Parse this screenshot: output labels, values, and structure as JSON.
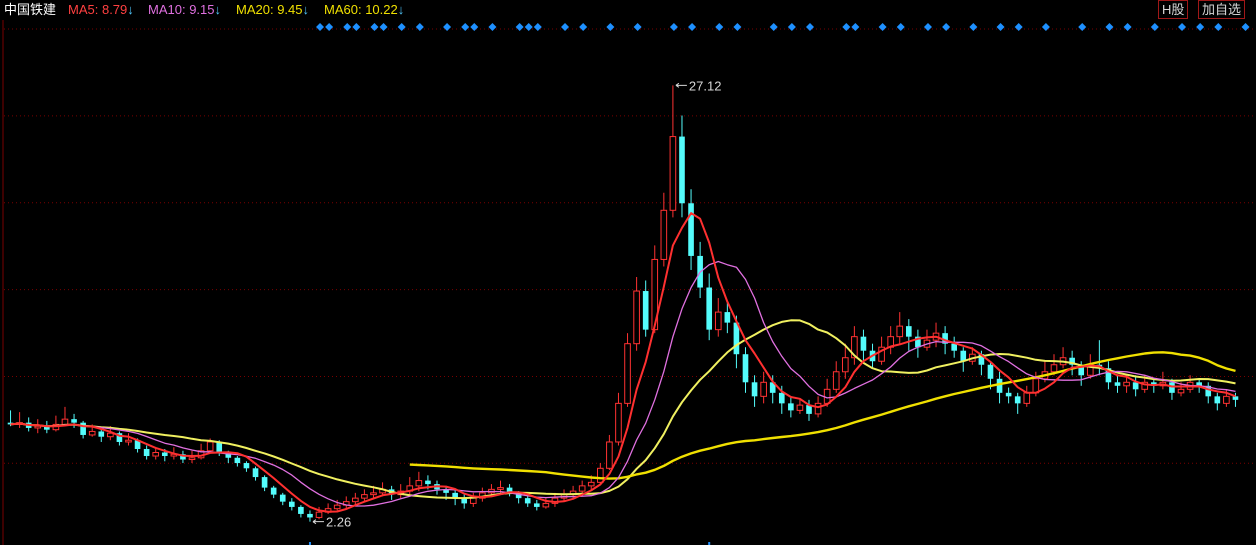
{
  "header": {
    "stock_name": "中国铁建",
    "indicators": [
      {
        "label": "MA5",
        "value": "8.79",
        "color": "#ff4040"
      },
      {
        "label": "MA10",
        "value": "9.15",
        "color": "#e070e0"
      },
      {
        "label": "MA20",
        "value": "9.45",
        "color": "#f0e000"
      },
      {
        "label": "MA60",
        "value": "10.22",
        "color": "#f0e000"
      }
    ],
    "arrow_glyph": "↓",
    "arrow_color": "#4fc3f7",
    "buttons": {
      "h_share": "H股",
      "add_watchlist": "加自选"
    }
  },
  "chart_data": {
    "type": "candlestick",
    "ylim": [
      1.5,
      30.5
    ],
    "grid": true,
    "max_label": "27.12",
    "min_label": "2.26",
    "colors": {
      "up": "#ff3232",
      "down": "#54fcfc",
      "ma5": "#ff3030",
      "ma10": "#e070e0",
      "ma20": "#f0f060",
      "ma60": "#f0e000",
      "marker": "#1e90ff",
      "grid": "#7a0000"
    },
    "candles": [
      [
        7.9,
        7.8,
        8.6,
        7.7
      ],
      [
        7.8,
        7.9,
        8.5,
        7.6
      ],
      [
        7.9,
        7.6,
        8.2,
        7.4
      ],
      [
        7.6,
        7.7,
        8.1,
        7.3
      ],
      [
        7.7,
        7.5,
        8.0,
        7.3
      ],
      [
        7.5,
        7.8,
        8.3,
        7.4
      ],
      [
        7.8,
        8.1,
        8.8,
        7.7
      ],
      [
        8.1,
        7.9,
        8.4,
        7.6
      ],
      [
        7.9,
        7.2,
        8.0,
        7.0
      ],
      [
        7.2,
        7.4,
        7.8,
        7.1
      ],
      [
        7.4,
        7.1,
        7.6,
        6.8
      ],
      [
        7.1,
        7.3,
        7.7,
        6.9
      ],
      [
        7.3,
        6.8,
        7.4,
        6.6
      ],
      [
        6.8,
        6.9,
        7.3,
        6.6
      ],
      [
        6.9,
        6.4,
        7.0,
        6.2
      ],
      [
        6.4,
        6.0,
        6.6,
        5.8
      ],
      [
        6.0,
        6.2,
        6.5,
        5.8
      ],
      [
        6.2,
        6.0,
        6.4,
        5.7
      ],
      [
        6.0,
        6.1,
        6.5,
        5.8
      ],
      [
        6.1,
        5.8,
        6.3,
        5.6
      ],
      [
        5.8,
        5.9,
        6.3,
        5.6
      ],
      [
        5.9,
        6.3,
        6.7,
        5.8
      ],
      [
        6.3,
        6.8,
        7.0,
        6.2
      ],
      [
        6.8,
        6.2,
        6.9,
        6.0
      ],
      [
        6.2,
        5.9,
        6.3,
        5.6
      ],
      [
        5.9,
        5.6,
        6.0,
        5.4
      ],
      [
        5.6,
        5.3,
        5.7,
        5.1
      ],
      [
        5.3,
        4.8,
        5.4,
        4.6
      ],
      [
        4.8,
        4.2,
        4.9,
        4.0
      ],
      [
        4.2,
        3.8,
        4.3,
        3.6
      ],
      [
        3.8,
        3.4,
        3.9,
        3.2
      ],
      [
        3.4,
        3.1,
        3.6,
        2.9
      ],
      [
        3.1,
        2.7,
        3.2,
        2.5
      ],
      [
        2.7,
        2.5,
        2.9,
        2.26
      ],
      [
        2.5,
        2.8,
        3.1,
        2.4
      ],
      [
        2.8,
        3.0,
        3.3,
        2.7
      ],
      [
        3.0,
        3.2,
        3.5,
        2.9
      ],
      [
        3.2,
        3.4,
        3.7,
        3.0
      ],
      [
        3.4,
        3.6,
        3.9,
        3.2
      ],
      [
        3.6,
        3.8,
        4.1,
        3.4
      ],
      [
        3.8,
        3.9,
        4.3,
        3.6
      ],
      [
        3.9,
        4.1,
        4.5,
        3.7
      ],
      [
        4.1,
        3.8,
        4.3,
        3.5
      ],
      [
        3.8,
        4.0,
        4.4,
        3.6
      ],
      [
        4.0,
        4.3,
        4.8,
        3.8
      ],
      [
        4.3,
        4.6,
        5.1,
        4.0
      ],
      [
        4.6,
        4.4,
        4.9,
        4.1
      ],
      [
        4.4,
        4.1,
        4.6,
        3.8
      ],
      [
        4.1,
        3.9,
        4.3,
        3.5
      ],
      [
        3.9,
        3.6,
        4.1,
        3.2
      ],
      [
        3.6,
        3.3,
        3.8,
        3.0
      ],
      [
        3.3,
        3.6,
        3.9,
        3.1
      ],
      [
        3.6,
        3.9,
        4.2,
        3.4
      ],
      [
        3.9,
        4.1,
        4.4,
        3.7
      ],
      [
        4.1,
        4.2,
        4.6,
        3.9
      ],
      [
        4.2,
        3.9,
        4.4,
        3.7
      ],
      [
        3.9,
        3.6,
        4.0,
        3.3
      ],
      [
        3.6,
        3.3,
        3.8,
        3.1
      ],
      [
        3.3,
        3.1,
        3.5,
        2.9
      ],
      [
        3.1,
        3.3,
        3.6,
        3.0
      ],
      [
        3.3,
        3.6,
        3.9,
        3.1
      ],
      [
        3.6,
        3.8,
        4.1,
        3.4
      ],
      [
        3.8,
        4.0,
        4.3,
        3.6
      ],
      [
        4.0,
        4.3,
        4.6,
        3.8
      ],
      [
        4.3,
        4.5,
        4.9,
        4.1
      ],
      [
        4.5,
        5.3,
        5.6,
        4.4
      ],
      [
        5.3,
        6.8,
        7.2,
        5.2
      ],
      [
        6.8,
        9.0,
        9.6,
        6.6
      ],
      [
        9.0,
        12.4,
        13.0,
        8.8
      ],
      [
        12.4,
        15.4,
        16.2,
        12.0
      ],
      [
        15.4,
        13.2,
        16.0,
        12.8
      ],
      [
        13.2,
        17.2,
        18.0,
        13.0
      ],
      [
        17.2,
        20.0,
        21.0,
        16.8
      ],
      [
        20.0,
        24.2,
        27.12,
        19.6
      ],
      [
        24.2,
        20.4,
        25.4,
        19.6
      ],
      [
        20.4,
        17.4,
        21.2,
        16.6
      ],
      [
        17.4,
        15.6,
        18.2,
        15.0
      ],
      [
        15.6,
        13.2,
        16.4,
        12.6
      ],
      [
        13.2,
        14.2,
        15.0,
        12.8
      ],
      [
        14.2,
        13.6,
        14.8,
        13.0
      ],
      [
        13.6,
        11.8,
        14.0,
        11.0
      ],
      [
        11.8,
        10.2,
        12.2,
        9.6
      ],
      [
        10.2,
        9.4,
        10.6,
        8.8
      ],
      [
        9.4,
        10.2,
        10.8,
        9.0
      ],
      [
        10.2,
        9.6,
        10.6,
        9.0
      ],
      [
        9.6,
        9.0,
        10.0,
        8.4
      ],
      [
        9.0,
        8.6,
        9.4,
        8.2
      ],
      [
        8.6,
        8.9,
        9.3,
        8.4
      ],
      [
        8.9,
        8.4,
        9.2,
        8.0
      ],
      [
        8.4,
        9.0,
        9.4,
        8.2
      ],
      [
        9.0,
        9.8,
        10.4,
        8.8
      ],
      [
        9.8,
        10.8,
        11.4,
        9.6
      ],
      [
        10.8,
        11.6,
        12.4,
        10.4
      ],
      [
        11.6,
        12.8,
        13.4,
        11.2
      ],
      [
        12.8,
        12.0,
        13.2,
        11.4
      ],
      [
        12.0,
        11.4,
        12.4,
        11.0
      ],
      [
        11.4,
        12.2,
        12.8,
        11.2
      ],
      [
        12.2,
        12.8,
        13.4,
        11.8
      ],
      [
        12.8,
        13.4,
        14.2,
        12.4
      ],
      [
        13.4,
        12.8,
        13.8,
        12.0
      ],
      [
        12.8,
        12.2,
        13.2,
        11.6
      ],
      [
        12.2,
        12.6,
        13.2,
        12.0
      ],
      [
        12.6,
        13.0,
        13.6,
        12.2
      ],
      [
        13.0,
        12.4,
        13.4,
        11.8
      ],
      [
        12.4,
        12.0,
        12.8,
        11.6
      ],
      [
        12.0,
        11.4,
        12.2,
        10.8
      ],
      [
        11.4,
        11.8,
        12.2,
        11.2
      ],
      [
        11.8,
        11.2,
        12.0,
        10.6
      ],
      [
        11.2,
        10.4,
        11.4,
        9.8
      ],
      [
        10.4,
        9.6,
        10.8,
        9.0
      ],
      [
        9.6,
        9.4,
        9.9,
        9.0
      ],
      [
        9.4,
        9.0,
        9.6,
        8.4
      ],
      [
        9.0,
        9.6,
        10.0,
        8.8
      ],
      [
        9.6,
        10.4,
        10.8,
        9.4
      ],
      [
        10.4,
        10.8,
        11.4,
        10.2
      ],
      [
        10.8,
        11.2,
        11.8,
        10.6
      ],
      [
        11.2,
        11.6,
        12.2,
        11.0
      ],
      [
        11.6,
        11.2,
        12.0,
        10.6
      ],
      [
        11.2,
        10.6,
        11.4,
        10.0
      ],
      [
        10.6,
        11.2,
        11.8,
        10.4
      ],
      [
        11.2,
        11.0,
        12.6,
        10.6
      ],
      [
        11.0,
        10.2,
        11.4,
        9.8
      ],
      [
        10.2,
        10.0,
        10.6,
        9.6
      ],
      [
        10.0,
        10.2,
        10.6,
        9.6
      ],
      [
        10.2,
        9.8,
        10.6,
        9.4
      ],
      [
        9.8,
        10.2,
        10.6,
        9.6
      ],
      [
        10.2,
        10.0,
        10.4,
        9.6
      ],
      [
        10.0,
        10.2,
        10.8,
        9.8
      ],
      [
        10.2,
        9.6,
        10.4,
        9.2
      ],
      [
        9.6,
        9.8,
        10.2,
        9.4
      ],
      [
        9.8,
        10.2,
        10.6,
        9.6
      ],
      [
        10.2,
        10.0,
        10.4,
        9.6
      ],
      [
        10.0,
        9.4,
        10.2,
        9.0
      ],
      [
        9.4,
        9.0,
        9.6,
        8.6
      ],
      [
        9.0,
        9.4,
        9.8,
        8.8
      ],
      [
        9.4,
        9.2,
        9.6,
        8.8
      ]
    ],
    "ma60_start_index": 44,
    "markers_top": [
      34,
      35,
      37,
      38,
      40,
      41,
      43,
      45,
      48,
      50,
      51,
      53,
      56,
      57,
      58,
      61,
      63,
      66,
      69,
      73,
      75,
      78,
      80,
      84,
      86,
      88,
      92,
      93,
      96,
      98,
      101,
      103,
      106,
      109,
      111,
      114,
      118,
      121,
      123,
      126,
      129,
      131,
      133,
      136,
      139,
      141,
      143,
      146,
      148,
      151,
      154,
      156,
      159,
      161,
      164,
      166,
      169,
      171,
      173,
      175
    ],
    "markers_bottom": [
      33,
      77
    ]
  }
}
